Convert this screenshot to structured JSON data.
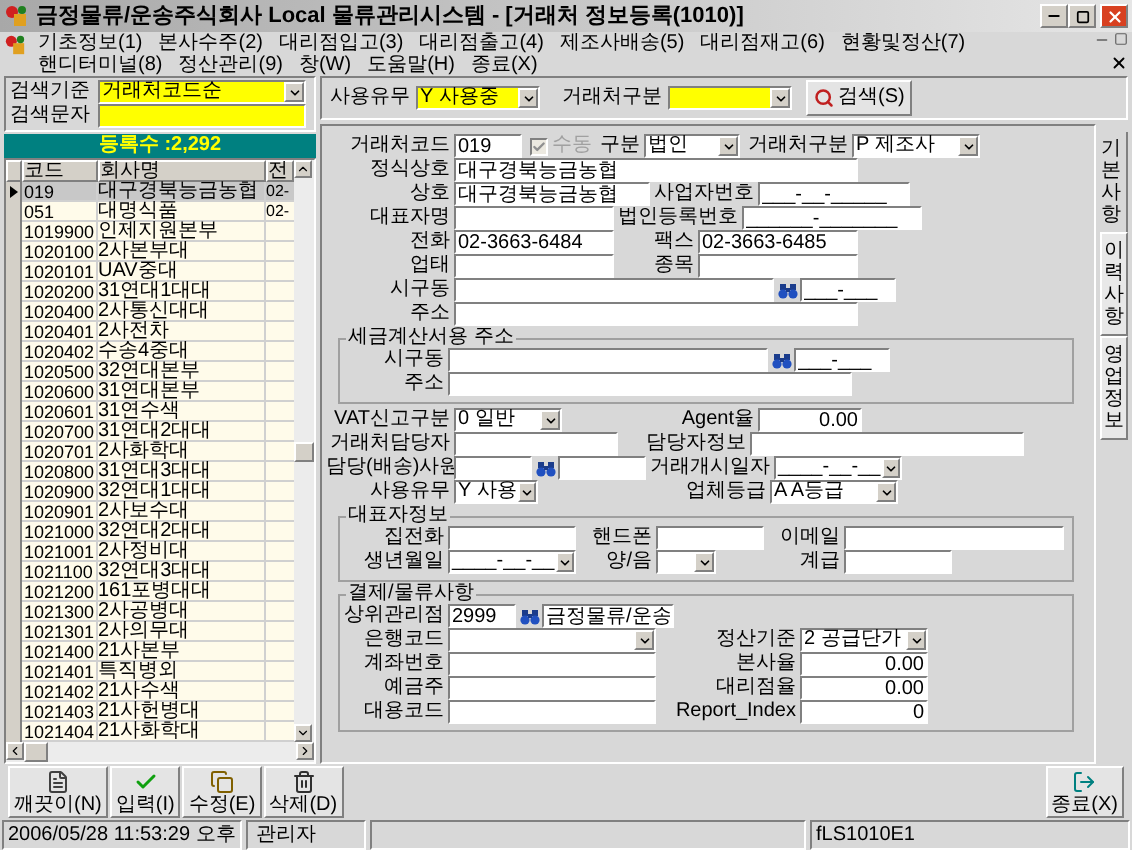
{
  "window": {
    "title": "금정물류/운송주식회사 Local 물류관리시스템 - [거래처 정보등록(1010)]"
  },
  "menu": [
    "기초정보(1)",
    "본사수주(2)",
    "대리점입고(3)",
    "대리점출고(4)",
    "제조사배송(5)",
    "대리점재고(6)",
    "현황및정산(7)",
    "핸디터미널(8)",
    "정산관리(9)",
    "창(W)",
    "도움말(H)",
    "종료(X)"
  ],
  "search": {
    "criteria_label": "검색기준",
    "criteria_value": "거래처코드순",
    "text_label": "검색문자"
  },
  "list": {
    "count": "등록수 :2,292",
    "columns": [
      "코드",
      "회사명",
      "전"
    ],
    "rows": [
      {
        "code": "019",
        "name": "대구경북능금농협",
        "phone": "02-",
        "selected": true
      },
      {
        "code": "051",
        "name": "대명식품",
        "phone": "02-",
        "selected": false
      },
      {
        "code": "1019900",
        "name": "인제지원본부",
        "selected": false
      },
      {
        "code": "1020100",
        "name": "2사본부대",
        "selected": false
      },
      {
        "code": "1020101",
        "name": "UAV중대",
        "selected": false
      },
      {
        "code": "1020200",
        "name": "31연대1대대",
        "selected": false
      },
      {
        "code": "1020400",
        "name": "2사통신대대",
        "selected": false
      },
      {
        "code": "1020401",
        "name": "2사전차",
        "selected": false
      },
      {
        "code": "1020402",
        "name": "수송4중대",
        "selected": false
      },
      {
        "code": "1020500",
        "name": "32연대본부",
        "selected": false
      },
      {
        "code": "1020600",
        "name": "31연대본부",
        "selected": false
      },
      {
        "code": "1020601",
        "name": "31연수색",
        "selected": false
      },
      {
        "code": "1020700",
        "name": "31연대2대대",
        "selected": false
      },
      {
        "code": "1020701",
        "name": "2사화학대",
        "selected": false
      },
      {
        "code": "1020800",
        "name": "31연대3대대",
        "selected": false
      },
      {
        "code": "1020900",
        "name": "32연대1대대",
        "selected": false
      },
      {
        "code": "1020901",
        "name": "2사보수대",
        "selected": false
      },
      {
        "code": "1021000",
        "name": "32연대2대대",
        "selected": false
      },
      {
        "code": "1021001",
        "name": "2사정비대",
        "selected": false
      },
      {
        "code": "1021100",
        "name": "32연대3대대",
        "selected": false
      },
      {
        "code": "1021200",
        "name": "161포병대대",
        "selected": false
      },
      {
        "code": "1021300",
        "name": "2사공병대",
        "selected": false
      },
      {
        "code": "1021301",
        "name": "2사의무대",
        "selected": false
      },
      {
        "code": "1021400",
        "name": "21사본부",
        "selected": false
      },
      {
        "code": "1021401",
        "name": "특직병외",
        "selected": false
      },
      {
        "code": "1021402",
        "name": "21사수색",
        "selected": false
      },
      {
        "code": "1021403",
        "name": "21사헌병대",
        "selected": false
      },
      {
        "code": "1021404",
        "name": "21사화학대",
        "selected": false
      }
    ]
  },
  "filters": {
    "use_label": "사용유무",
    "use_value": "Y 사용중",
    "type_label": "거래처구분",
    "search_button": "검색(S)"
  },
  "form": {
    "main": [
      [
        {
          "kind": "text",
          "label": "거래처코드",
          "value": "019"
        },
        {
          "kind": "check",
          "label": "수동",
          "checked": true,
          "disabled": true
        },
        {
          "kind": "select",
          "label": "구분",
          "value": "법인"
        },
        {
          "kind": "select",
          "label": "거래처구분",
          "value": "P 제조사"
        }
      ],
      [
        {
          "kind": "text",
          "label": "정식상호",
          "value": "대구경북능금농협"
        }
      ],
      [
        {
          "kind": "text",
          "label": "상호",
          "value": "대구경북능금농협"
        },
        {
          "kind": "text",
          "label": "사업자번호",
          "value": "___-__-_____"
        }
      ],
      [
        {
          "kind": "text",
          "label": "대표자명"
        },
        {
          "kind": "text",
          "label": "법인등록번호",
          "value": "______-_______"
        }
      ],
      [
        {
          "kind": "text",
          "label": "전화",
          "value": "02-3663-6484"
        },
        {
          "kind": "text",
          "label": "팩스",
          "value": "02-3663-6485"
        }
      ],
      [
        {
          "kind": "text",
          "label": "업태"
        },
        {
          "kind": "text",
          "label": "종목"
        }
      ],
      [
        {
          "kind": "address",
          "label": "시구동",
          "zip": "___-___"
        }
      ],
      [
        {
          "kind": "text",
          "label": "주소"
        }
      ]
    ],
    "tax_address": {
      "title": "세금계산서용 주소",
      "rows": [
        [
          {
            "kind": "address",
            "label": "시구동",
            "zip": "___-___"
          }
        ],
        [
          {
            "kind": "text",
            "label": "주소"
          }
        ]
      ]
    },
    "misc": [
      [
        {
          "kind": "select",
          "label": "VAT신고구분",
          "value": "0 일반"
        },
        {
          "kind": "number",
          "label": "Agent율",
          "value": "0.00"
        }
      ],
      [
        {
          "kind": "text",
          "label": "거래처담당자"
        },
        {
          "kind": "text",
          "label": "담당자정보"
        }
      ],
      [
        {
          "kind": "lookup",
          "label": "담당(배송)사원"
        },
        {
          "kind": "select",
          "label": "거래개시일자",
          "value": "____-__-__"
        }
      ],
      [
        {
          "kind": "select",
          "label": "사용유무",
          "value": "Y 사용"
        },
        {
          "kind": "select",
          "label": "업체등급",
          "value": "A A등급"
        }
      ]
    ],
    "representative": {
      "title": "대표자정보",
      "rows": [
        [
          {
            "kind": "text",
            "label": "집전화"
          },
          {
            "kind": "text",
            "label": "핸드폰"
          },
          {
            "kind": "text",
            "label": "이메일"
          }
        ],
        [
          {
            "kind": "select",
            "label": "생년월일",
            "value": "____-__-__"
          },
          {
            "kind": "select",
            "label": "양/음"
          },
          {
            "kind": "text",
            "label": "계급"
          }
        ]
      ]
    },
    "settlement": {
      "title": "결제/물류사항",
      "rows": [
        [
          {
            "kind": "lookup",
            "label": "상위관리점",
            "value": "2999",
            "name": "금정물류/운송"
          }
        ],
        [
          {
            "kind": "select",
            "label": "은행코드"
          },
          {
            "kind": "select",
            "label": "정산기준",
            "value": "2 공급단가"
          }
        ],
        [
          {
            "kind": "text",
            "label": "계좌번호"
          },
          {
            "kind": "number",
            "label": "본사율",
            "value": "0.00"
          }
        ],
        [
          {
            "kind": "text",
            "label": "예금주"
          },
          {
            "kind": "number",
            "label": "대리점율",
            "value": "0.00"
          }
        ],
        [
          {
            "kind": "text",
            "label": "대용코드"
          },
          {
            "kind": "number",
            "label": "Report_Index",
            "value": "0"
          }
        ]
      ]
    }
  },
  "side_tabs": [
    {
      "label": "기본사항",
      "selected": true
    },
    {
      "label": "이력사항",
      "selected": false
    },
    {
      "label": "영업정보",
      "selected": false
    }
  ],
  "actions": [
    {
      "kind": "new",
      "label": "깨끗이(N)"
    },
    {
      "kind": "save",
      "label": "입력(I)"
    },
    {
      "kind": "edit",
      "label": "수정(E)"
    },
    {
      "kind": "delete",
      "label": "삭제(D)"
    }
  ],
  "exit_button": {
    "kind": "exit",
    "label": "종료(X)"
  },
  "status_bar": [
    "2006/05/28 11:53:29 오후",
    "관리자",
    "fLS1010E1"
  ]
}
